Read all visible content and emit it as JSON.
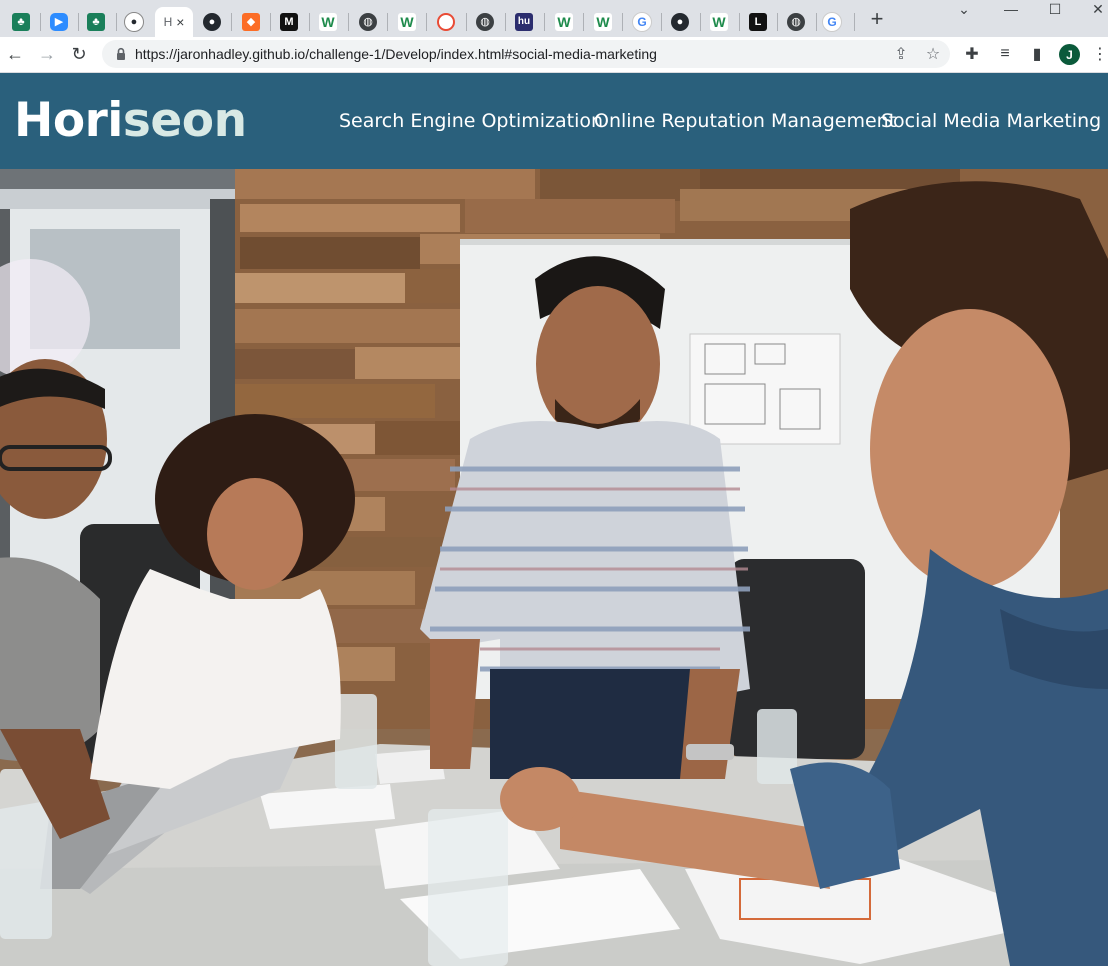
{
  "browser": {
    "tabs": [
      {
        "icon": "tree-logo-icon",
        "color": "#1a7f5a"
      },
      {
        "icon": "zoom-icon",
        "color": "#2d8cff"
      },
      {
        "icon": "tree-logo-icon",
        "color": "#1a7f5a"
      },
      {
        "icon": "github-icon",
        "color": "#24292f"
      },
      {
        "icon": "page-icon",
        "active": true,
        "label": "H",
        "close": "×"
      },
      {
        "icon": "github-icon",
        "color": "#24292f"
      },
      {
        "icon": "gitlab-icon",
        "color": "#fc6d26"
      },
      {
        "icon": "m-logo-icon",
        "color": "#111111"
      },
      {
        "icon": "w-logo-icon",
        "color": "#1e8b4c"
      },
      {
        "icon": "globe-icon",
        "color": "#3c4043"
      },
      {
        "icon": "w-logo-icon",
        "color": "#1e8b4c"
      },
      {
        "icon": "circle-logo-icon",
        "color": "#e94b35"
      },
      {
        "icon": "globe-icon",
        "color": "#3c4043"
      },
      {
        "icon": "hu-logo-icon",
        "color": "#2b2d6e"
      },
      {
        "icon": "w-logo-icon",
        "color": "#1e8b4c"
      },
      {
        "icon": "w-logo-icon",
        "color": "#1e8b4c"
      },
      {
        "icon": "google-icon",
        "color": "#4285f4"
      },
      {
        "icon": "github-icon",
        "color": "#24292f"
      },
      {
        "icon": "w-logo-icon",
        "color": "#1e8b4c"
      },
      {
        "icon": "l-logo-icon",
        "color": "#111111"
      },
      {
        "icon": "globe-icon",
        "color": "#3c4043"
      },
      {
        "icon": "google-icon",
        "color": "#4285f4"
      }
    ],
    "url": "https://jaronhadley.github.io/challenge-1/Develop/index.html#social-media-marketing",
    "profile_initial": "J"
  },
  "site": {
    "logo_prefix": "Hori",
    "logo_suffix": "seon",
    "nav": [
      {
        "label": "Search Engine Optimization"
      },
      {
        "label": "Online Reputation Management"
      },
      {
        "label": "Social Media Marketing"
      }
    ],
    "header_color": "#2a607c",
    "logo_accent_color": "#d9e9e5"
  }
}
